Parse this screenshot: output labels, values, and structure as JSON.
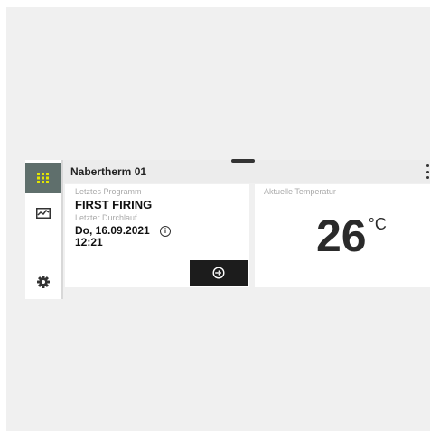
{
  "device": {
    "name": "Nabertherm 01"
  },
  "nav": {
    "items": [
      {
        "icon": "grid-icon",
        "active": true
      },
      {
        "icon": "chart-icon",
        "active": false
      },
      {
        "icon": "gear-icon",
        "active": false
      }
    ],
    "active_color": "#5f6f6c",
    "active_icon_color": "#e3e600"
  },
  "last_program": {
    "label": "Letztes Programm",
    "name": "FIRST FIRING",
    "run_label": "Letzter Durchlauf",
    "run_date": "Do, 16.09.2021",
    "run_time": "12:21",
    "info_symbol": "i",
    "start_button_icon": "start-program-icon"
  },
  "temperature": {
    "label": "Aktuelle Temperatur",
    "value": "26",
    "unit": "°C"
  },
  "colors": {
    "background": "#f0f0f0",
    "card": "#ffffff",
    "button": "#1c1c1c"
  }
}
